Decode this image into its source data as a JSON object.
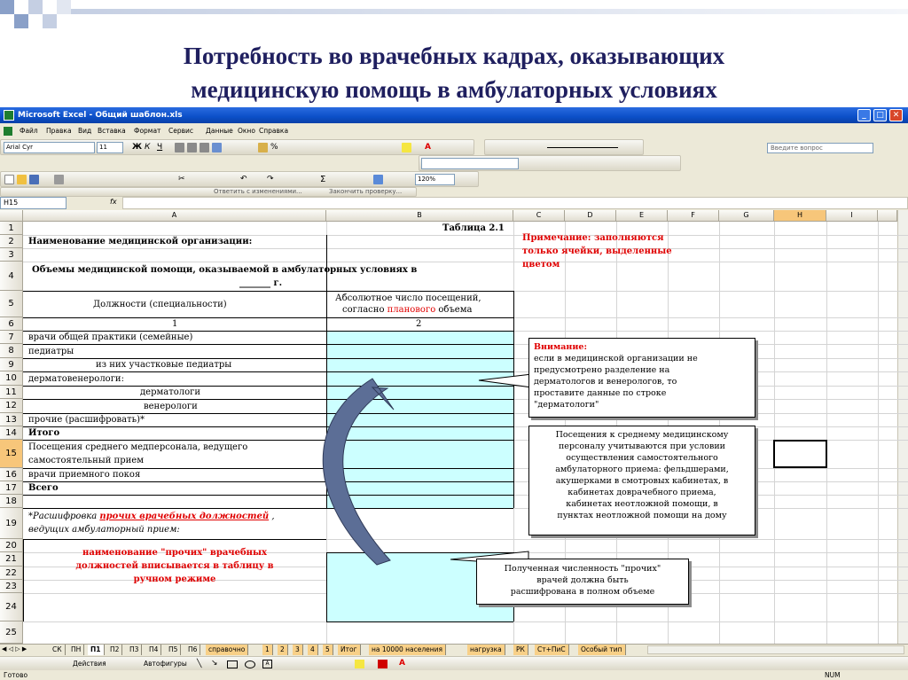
{
  "slide": {
    "title_line1": "Потребность во врачебных кадрах, оказывающих",
    "title_line2": "медицинскую помощь в амбулаторных условиях"
  },
  "window": {
    "title": "Microsoft Excel - Общий шаблон.xls",
    "ask_placeholder": "Введите вопрос"
  },
  "menu": [
    "Файл",
    "Правка",
    "Вид",
    "Вставка",
    "Формат",
    "Сервис",
    "Данные",
    "Окно",
    "Справка"
  ],
  "toolbar": {
    "font_name": "Arial Cyr",
    "font_size": "11",
    "zoom": "120%",
    "review_reply": "Ответить с изменениями...",
    "review_end": "Закончить проверку..."
  },
  "formula_bar": {
    "name_box": "H15",
    "fx": "fx"
  },
  "columns": [
    "A",
    "B",
    "C",
    "D",
    "E",
    "F",
    "G",
    "H",
    "I"
  ],
  "selected_column": "H",
  "rows": [
    "1",
    "2",
    "3",
    "4",
    "5",
    "6",
    "7",
    "8",
    "9",
    "10",
    "11",
    "12",
    "13",
    "14",
    "15",
    "16",
    "17",
    "18",
    "19",
    "20",
    "21",
    "22",
    "23",
    "24",
    "25"
  ],
  "selected_row": "15",
  "cells": {
    "table_number": "Таблица 2.1",
    "org_name_label": "Наименование медицинской организации:",
    "volumes_line1": "Объемы медицинской помощи, оказываемой в амбулаторных условиях в",
    "volumes_line2": "_______ г.",
    "positions_header": "Должности (специальности)",
    "visits_header_line1": "Абсолютное число посещений,",
    "visits_header_pre": "согласно ",
    "visits_header_red": "планового",
    "visits_header_post": " объема",
    "col_num_1": "1",
    "col_num_2": "2",
    "r7": "врачи общей практики (семейные)",
    "r8": "педиатры",
    "r9": "из них участковые педиатры",
    "r10": "дерматовенерологи:",
    "r11": "дерматологи",
    "r12": "венерологи",
    "r13": "прочие (расшифровать)*",
    "r14": "Итого",
    "r15a": "Посещения среднего медперсонала, ведущего",
    "r15b": "самостоятельный прием",
    "r16": "врачи приемного покоя",
    "r17": "Всего",
    "r19a_pre": "*Расшифровка  ",
    "r19a_red": "прочих врачебных должностей",
    "r19a_post": " ,",
    "r19b": "ведущих амбулаторный прием:",
    "note_red_1": "наименование \"прочих\" врачебных",
    "note_red_2": "должностей вписывается в таблицу в",
    "note_red_3": "ручном режиме"
  },
  "annotations": {
    "top_note_1": "Примечание: заполняются",
    "top_note_2": "только ячейки, выделенные",
    "top_note_3": "цветом",
    "attention_title": "Внимание:",
    "attention_lines": [
      "если в медицинской организации не",
      "предусмотрено разделение на",
      "дерматологов и венерологов, то",
      "проставите данные по строке",
      "\"дерматологи\""
    ],
    "nurse_lines": [
      "Посещения к среднему медицинскому",
      "персоналу учитываются при условии",
      "осуществления самостоятельного",
      "амбулаторного приема: фельдшерами,",
      "акушерками в смотровых кабинетах, в",
      "кабинетах доврачебного приема,",
      "кабинетах неотложной помощи, в",
      "пунктах неотложной помощи на дому"
    ],
    "others_lines": [
      "Полученная численность \"прочих\"",
      "врачей должна быть",
      "расшифрована в полном объеме"
    ]
  },
  "sheet_tabs": [
    "СК",
    "ПН",
    "П1",
    "П2",
    "П3",
    "П4",
    "П5",
    "П6",
    "справочно",
    "1",
    "2",
    "3",
    "4",
    "5",
    "Итог",
    "на 10000 населения",
    "нагрузка",
    "РК",
    "Ст+ПиС",
    "Особый тип"
  ],
  "active_tab": "П1",
  "drawing": {
    "actions": "Действия",
    "autoshapes": "Автофигуры"
  },
  "status": {
    "ready": "Готово",
    "num": "NUM"
  },
  "colors": {
    "fill": "#ccffff",
    "note_red": "#e00000",
    "title_navy": "#1f1f5f"
  }
}
